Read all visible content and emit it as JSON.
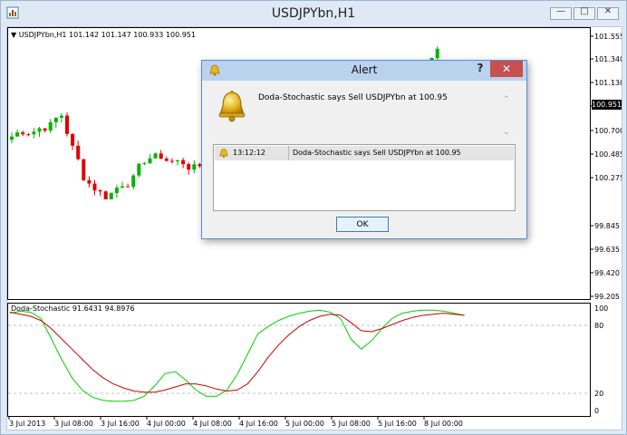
{
  "window": {
    "title": "USDJPYbn,H1",
    "minimize_glyph": "—",
    "maximize_glyph": "□",
    "close_glyph": "✕"
  },
  "chart": {
    "symbol_label": "USDJPYbn,H1  101.142 101.147 100.933 100.951",
    "price_axis": [
      "101.555",
      "101.340",
      "101.130",
      "100.915",
      "100.700",
      "100.485",
      "100.275",
      "99.845",
      "99.635",
      "99.420",
      "99.205"
    ],
    "current_price": "100.951",
    "time_axis": [
      "3 Jul 2013",
      "3 Jul 08:00",
      "3 Jul 16:00",
      "4 Jul 00:00",
      "4 Jul 08:00",
      "4 Jul 16:00",
      "5 Jul 00:00",
      "5 Jul 08:00",
      "5 Jul 16:00",
      "8 Jul 00:00"
    ],
    "osc_label": "Doda-Stochastic 91.6431 94.8976",
    "osc_axis": [
      "100",
      "80",
      "20",
      "0"
    ],
    "up_color": "#00b400",
    "down_color": "#e00000",
    "signal_color": "#00d000",
    "main_color": "#cc0000"
  },
  "alert": {
    "title": "Alert",
    "help": "?",
    "close": "✕",
    "message": "Doda-Stochastic says Sell  USDJPYbn at 100.95",
    "rows": [
      {
        "time": "13:12:12",
        "message": "Doda-Stochastic says Sell  USDJPYbn at 100.95"
      }
    ],
    "ok_label": "OK"
  },
  "icons": [
    "bell-icon",
    "chart-icon",
    "scroll-up-icon",
    "scroll-down-icon",
    "dropdown-triangle-icon"
  ]
}
